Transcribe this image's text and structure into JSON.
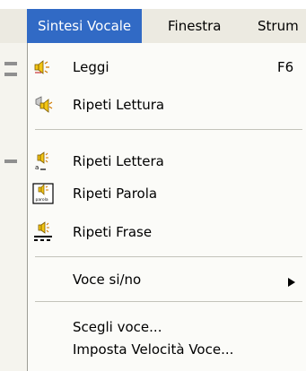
{
  "menubar": {
    "items": [
      {
        "label": "Sintesi Vocale",
        "active": true
      },
      {
        "label": "Finestra"
      },
      {
        "label": "Strum"
      }
    ]
  },
  "menu": {
    "items": [
      {
        "label": "Leggi",
        "shortcut": "F6",
        "icon": "speaker-read-icon"
      },
      {
        "label": "Ripeti Lettura",
        "icon": "speaker-repeat-icon"
      },
      {
        "label": "Ripeti Lettera",
        "icon": "speaker-letter-icon"
      },
      {
        "label": "Ripeti Parola",
        "icon": "speaker-word-icon",
        "icon_caption": "parola"
      },
      {
        "label": "Ripeti Frase",
        "icon": "speaker-phrase-icon"
      },
      {
        "label": "Voce si/no",
        "submenu": true,
        "arrow": "▶"
      },
      {
        "label": "Scegli voce..."
      },
      {
        "label": "Imposta Velocità Voce..."
      }
    ]
  },
  "colors": {
    "highlight": "#316ac5",
    "menubar_bg": "#eceae1",
    "menu_bg": "#fbfbf8",
    "separator": "#c3c3bb",
    "speaker_yellow": "#f3c515"
  }
}
